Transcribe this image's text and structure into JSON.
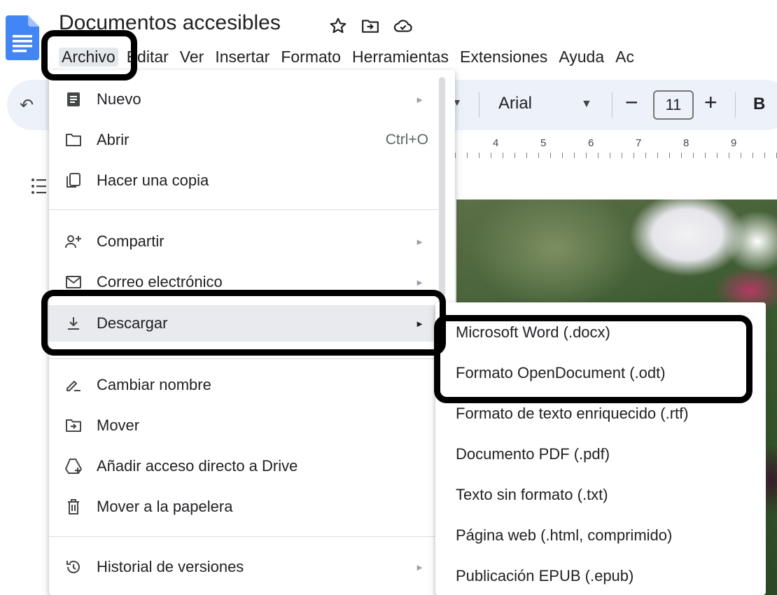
{
  "document": {
    "title": "Documentos accesibles"
  },
  "icons": {
    "app": "google-docs-icon",
    "star": "star-icon",
    "move": "move-to-folder-icon",
    "cloud": "cloud-saved-icon"
  },
  "menubar": {
    "items": [
      "Archivo",
      "Editar",
      "Ver",
      "Insertar",
      "Formato",
      "Herramientas",
      "Extensiones",
      "Ayuda",
      "Ac"
    ]
  },
  "toolbar": {
    "font_name": "Arial",
    "font_size": "11",
    "minus": "−",
    "plus": "+",
    "bold": "B"
  },
  "ruler": {
    "numbers": [
      "4",
      "5",
      "6",
      "7",
      "8",
      "9"
    ]
  },
  "file_menu": {
    "items": [
      {
        "label": "Nuevo",
        "icon": "new-document-icon",
        "submenu": true
      },
      {
        "label": "Abrir",
        "icon": "folder-icon",
        "shortcut": "Ctrl+O"
      },
      {
        "label": "Hacer una copia",
        "icon": "copy-icon"
      },
      {
        "label": "Compartir",
        "icon": "share-person-icon",
        "submenu": true
      },
      {
        "label": "Correo electrónico",
        "icon": "email-icon",
        "submenu": true
      },
      {
        "label": "Descargar",
        "icon": "download-icon",
        "submenu": true,
        "highlighted": true
      },
      {
        "label": "Cambiar nombre",
        "icon": "rename-icon"
      },
      {
        "label": "Mover",
        "icon": "move-folder-icon"
      },
      {
        "label": "Añadir acceso directo a Drive",
        "icon": "drive-shortcut-icon"
      },
      {
        "label": "Mover a la papelera",
        "icon": "trash-icon"
      },
      {
        "label": "Historial de versiones",
        "icon": "history-icon",
        "submenu": true
      }
    ]
  },
  "download_submenu": {
    "items": [
      "Microsoft Word (.docx)",
      "Formato OpenDocument (.odt)",
      "Formato de texto enriquecido (.rtf)",
      "Documento PDF (.pdf)",
      "Texto sin formato (.txt)",
      "Página web (.html, comprimido)",
      "Publicación EPUB (.epub)"
    ]
  },
  "colors": {
    "accent": "#4285f4",
    "menu_highlight": "#e8eaed",
    "toolbar_bg": "#edf2fa",
    "annotation": "#000000"
  }
}
